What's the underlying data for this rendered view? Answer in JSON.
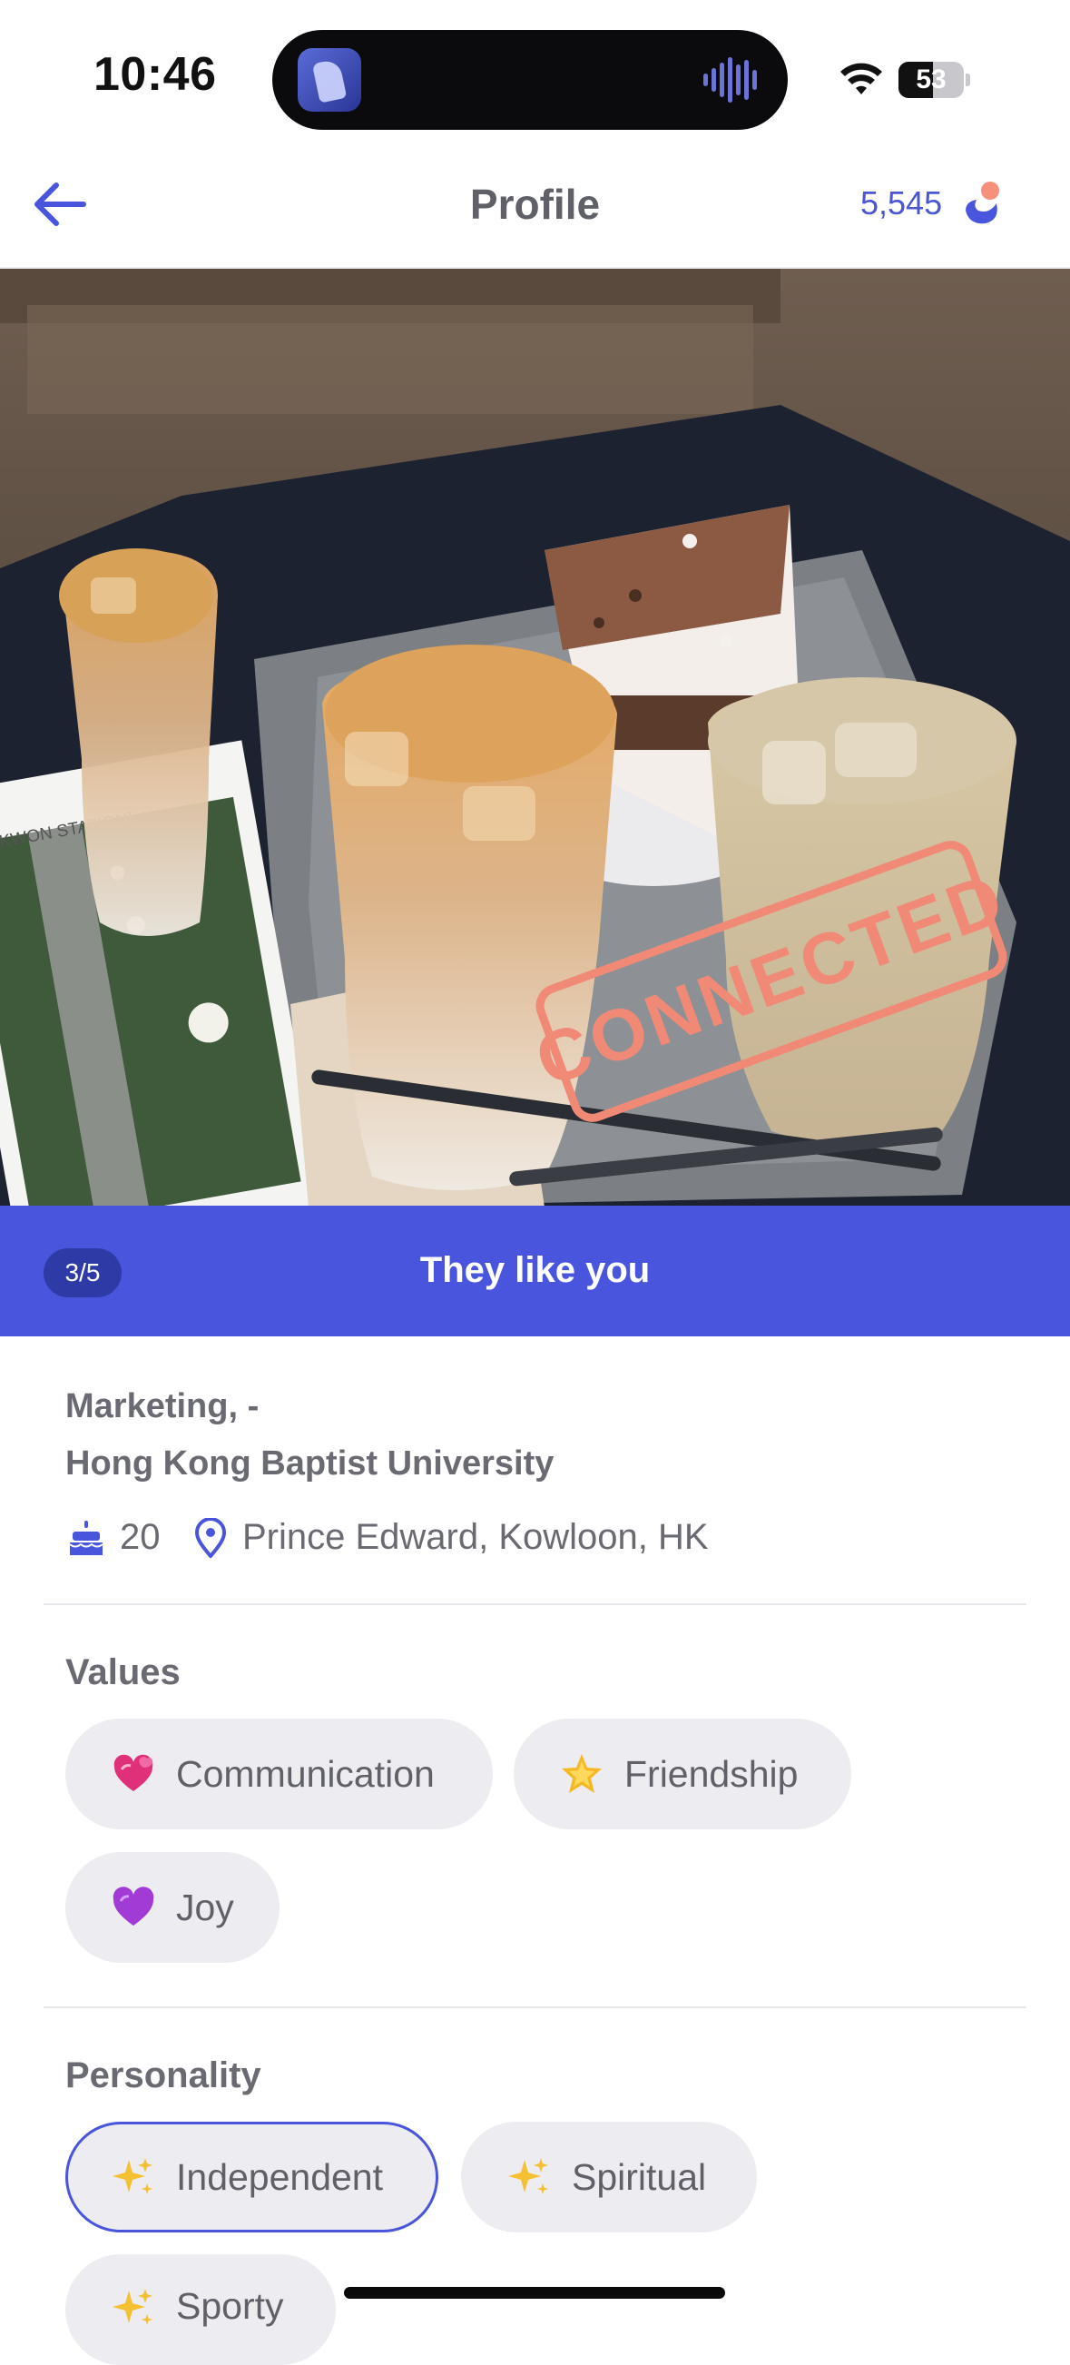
{
  "status_bar": {
    "time": "10:46",
    "battery": "53",
    "battery_fraction": 0.53
  },
  "header": {
    "title": "Profile",
    "coins": "5,545"
  },
  "photo": {
    "stamp_text": "CONNECTED",
    "postcard_caption": "[NAKWON STATION]",
    "counter": "3/5",
    "banner_text": "They like you"
  },
  "profile": {
    "major": "Marketing, -",
    "school": "Hong Kong Baptist University",
    "age": "20",
    "location": "Prince Edward, Kowloon, HK"
  },
  "values": {
    "title": "Values",
    "items": [
      {
        "label": "Communication",
        "icon": "hearts-icon"
      },
      {
        "label": "Friendship",
        "icon": "star-icon"
      },
      {
        "label": "Joy",
        "icon": "purple-heart-icon"
      }
    ]
  },
  "personality": {
    "title": "Personality",
    "items": [
      {
        "label": "Independent",
        "icon": "sparkles-icon",
        "selected": true
      },
      {
        "label": "Spiritual",
        "icon": "sparkles-icon",
        "selected": false
      },
      {
        "label": "Sporty",
        "icon": "sparkles-icon",
        "selected": false
      }
    ]
  },
  "colors": {
    "accent": "#4a55dd",
    "chip_bg": "#ededf1",
    "text": "#6a6b72",
    "stamp": "#f08a76"
  }
}
